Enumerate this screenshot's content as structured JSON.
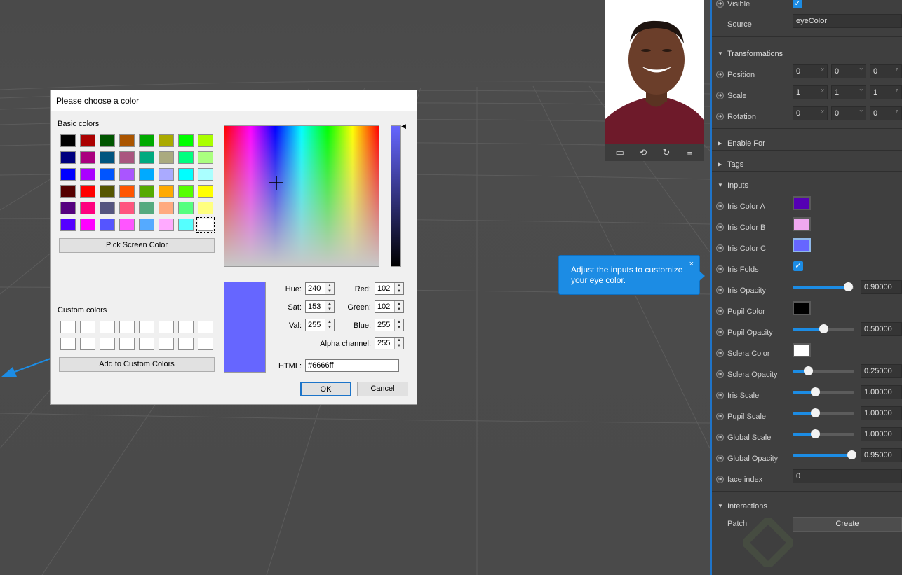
{
  "dialog": {
    "title": "Please choose a color",
    "basic_colors_label": "Basic colors",
    "basic_colors": [
      "#000000",
      "#aa0000",
      "#005500",
      "#aa5500",
      "#00aa00",
      "#aaaa00",
      "#00ff00",
      "#aaff00",
      "#00007f",
      "#aa007f",
      "#00557f",
      "#aa557f",
      "#00aa7f",
      "#aaaa7f",
      "#00ff7f",
      "#aaff7f",
      "#0000ff",
      "#aa00ff",
      "#0055ff",
      "#aa55ff",
      "#00aaff",
      "#aaaaff",
      "#00ffff",
      "#aaffff",
      "#550000",
      "#ff0000",
      "#555500",
      "#ff5500",
      "#55aa00",
      "#ffaa00",
      "#55ff00",
      "#ffff00",
      "#55007f",
      "#ff007f",
      "#55557f",
      "#ff557f",
      "#55aa7f",
      "#ffaa7f",
      "#55ff7f",
      "#ffff7f",
      "#5500ff",
      "#ff00ff",
      "#5555ff",
      "#ff55ff",
      "#55aaff",
      "#ffaaff",
      "#55ffff",
      "#ffffff"
    ],
    "pick_screen_label": "Pick Screen Color",
    "custom_colors_label": "Custom colors",
    "add_custom_label": "Add to Custom Colors",
    "current_color": "#6666ff",
    "fields": {
      "hue_label": "Hue:",
      "hue": "240",
      "sat_label": "Sat:",
      "sat": "153",
      "val_label": "Val:",
      "val": "255",
      "red_label": "Red:",
      "red": "102",
      "green_label": "Green:",
      "green": "102",
      "blue_label": "Blue:",
      "blue": "255",
      "alpha_label": "Alpha channel:",
      "alpha": "255",
      "html_label": "HTML:",
      "html": "#6666ff"
    },
    "ok_label": "OK",
    "cancel_label": "Cancel"
  },
  "tooltip": {
    "text": "Adjust the inputs to customize your eye color.",
    "close": "×"
  },
  "preview_toolbar": [
    "video-icon",
    "switch-camera-icon",
    "rotate-icon",
    "menu-icon"
  ],
  "inspector": {
    "visible_label": "Visible",
    "source_label": "Source",
    "source_value": "eyeColor",
    "transformations_label": "Transformations",
    "position_label": "Position",
    "position": [
      "0",
      "0",
      "0"
    ],
    "scale_label": "Scale",
    "scale": [
      "1",
      "1",
      "1"
    ],
    "rotation_label": "Rotation",
    "rotation": [
      "0",
      "0",
      "0"
    ],
    "axes": [
      "X",
      "Y",
      "Z"
    ],
    "enable_for_label": "Enable For",
    "tags_label": "Tags",
    "inputs_label": "Inputs",
    "iris_color_a_label": "Iris Color A",
    "iris_color_a": "#5500b3",
    "iris_color_b_label": "Iris Color B",
    "iris_color_b": "#f0a8f0",
    "iris_color_c_label": "Iris Color C",
    "iris_color_c": "#6666ff",
    "iris_folds_label": "Iris Folds",
    "iris_opacity_label": "Iris Opacity",
    "iris_opacity": "0.90000",
    "iris_opacity_level": 0.9,
    "pupil_color_label": "Pupil Color",
    "pupil_color": "#000000",
    "pupil_opacity_label": "Pupil Opacity",
    "pupil_opacity": "0.50000",
    "pupil_opacity_level": 0.5,
    "sclera_color_label": "Sclera Color",
    "sclera_color": "#ffffff",
    "sclera_opacity_label": "Sclera Opacity",
    "sclera_opacity": "0.25000",
    "sclera_opacity_level": 0.25,
    "iris_scale_label": "Iris Scale",
    "iris_scale": "1.00000",
    "pupil_scale_label": "Pupil Scale",
    "pupil_scale": "1.00000",
    "global_scale_label": "Global Scale",
    "global_scale": "1.00000",
    "global_opacity_label": "Global Opacity",
    "global_opacity": "0.95000",
    "global_opacity_level": 0.95,
    "face_index_label": "face index",
    "face_index": "0",
    "interactions_label": "Interactions",
    "patch_label": "Patch",
    "create_label": "Create"
  }
}
